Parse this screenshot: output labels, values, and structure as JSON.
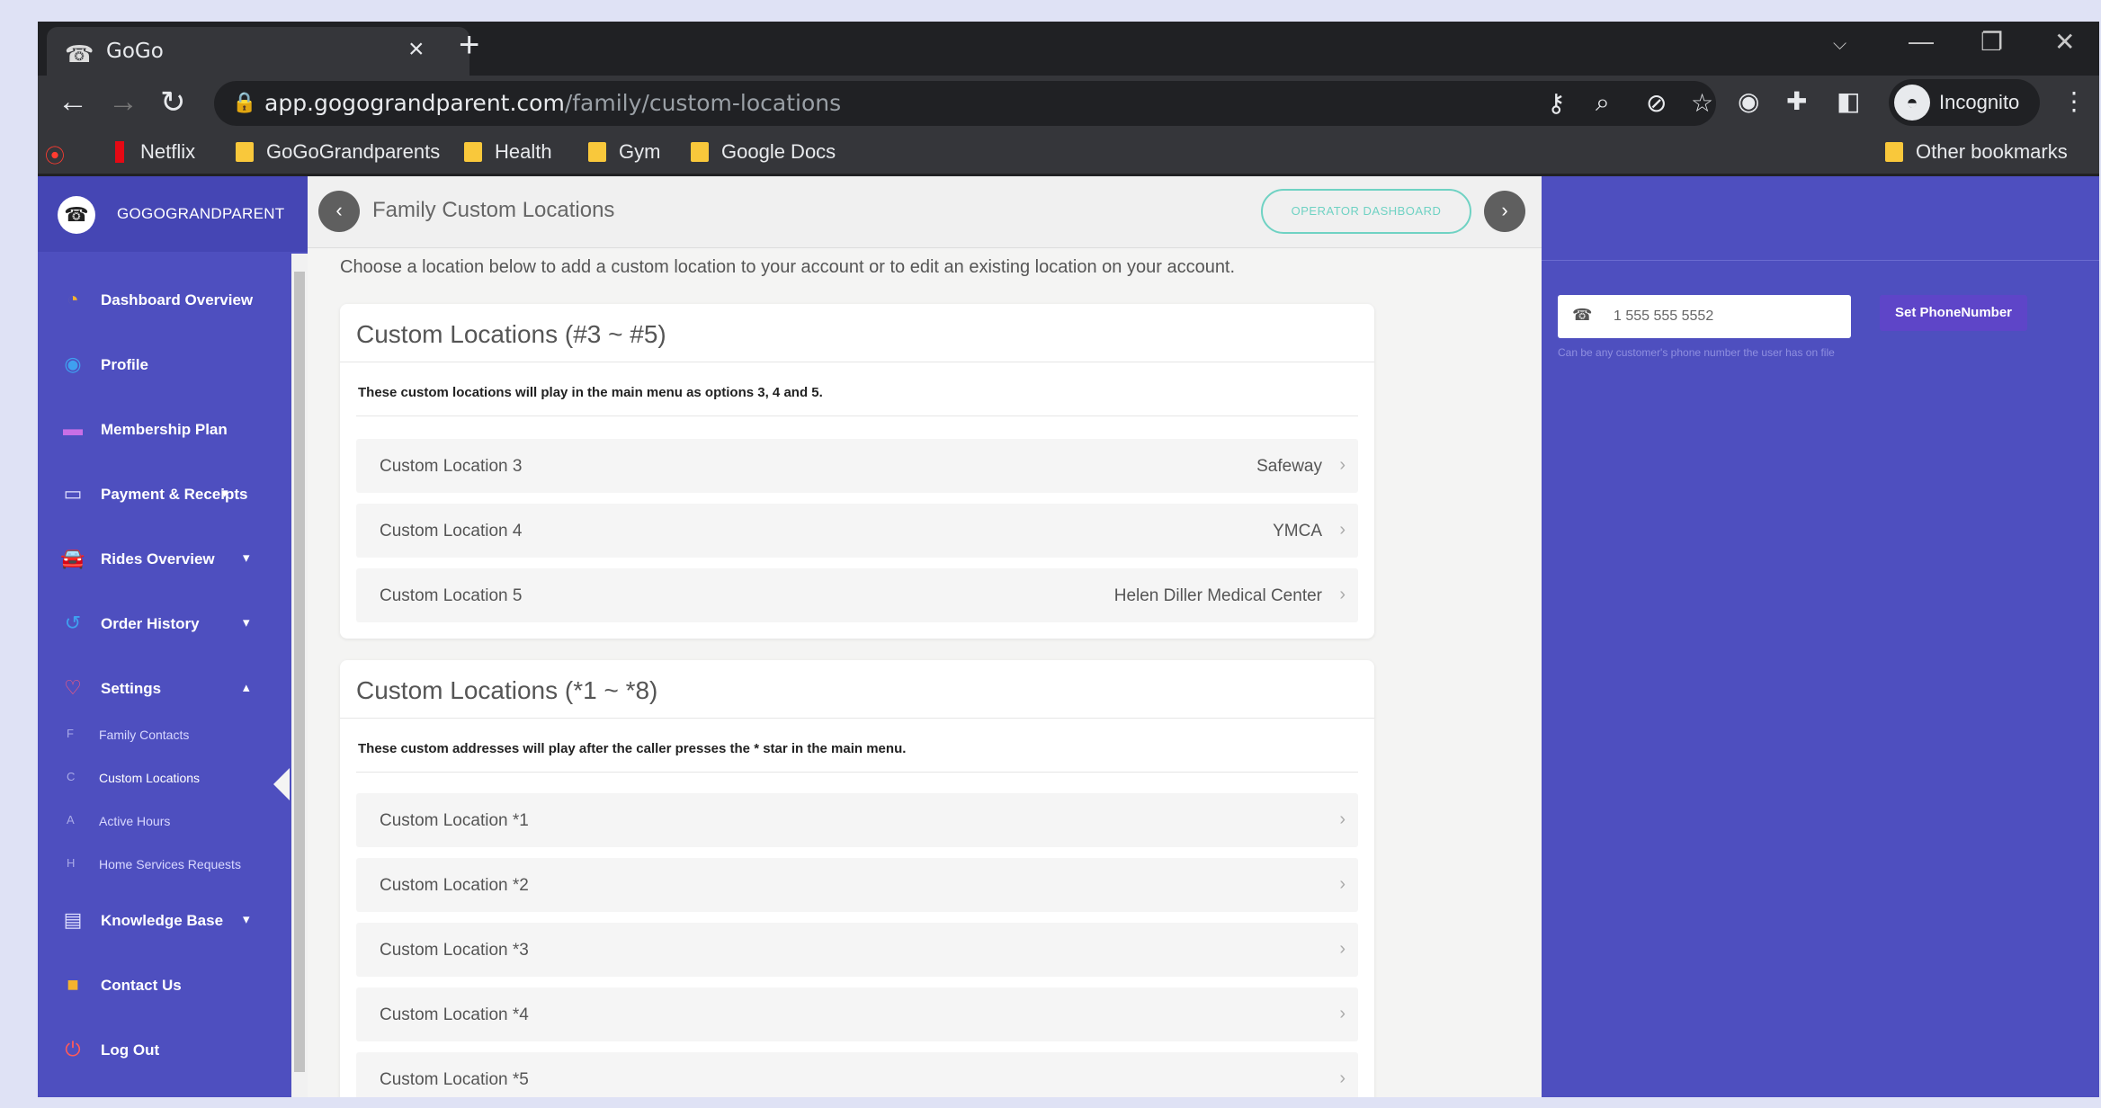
{
  "browser": {
    "tab_title": "GoGo",
    "tab_close": "×",
    "new_tab": "+",
    "url_host": "app.gogograndparent.com",
    "url_path": "/family/custom-locations",
    "incognito_label": "Incognito",
    "bookmarks": [
      "Netflix",
      "GoGoGrandparents",
      "Health",
      "Gym",
      "Google Docs"
    ],
    "other_bookmarks": "Other bookmarks"
  },
  "sidebar": {
    "brand": "GOGOGRANDPARENT",
    "items": [
      {
        "label": "Dashboard Overview",
        "icon": "dashboard-icon",
        "color": "#f5b32e"
      },
      {
        "label": "Profile",
        "icon": "profile-icon",
        "color": "#3fa0f0"
      },
      {
        "label": "Membership Plan",
        "icon": "membership-card-icon",
        "color": "#c86fe6"
      },
      {
        "label": "Payment & Receipts",
        "icon": "payment-icon",
        "caret": "▾",
        "color": "#e0e0ff"
      },
      {
        "label": "Rides Overview",
        "icon": "car-icon",
        "caret": "▾",
        "color": "#f5b32e"
      },
      {
        "label": "Order History",
        "icon": "history-icon",
        "caret": "▾",
        "color": "#3fa0f0"
      },
      {
        "label": "Settings",
        "icon": "heart-icon",
        "caret": "▴",
        "color": "#ff5a7a"
      }
    ],
    "subitems": [
      {
        "label": "Family Contacts",
        "marker": "F"
      },
      {
        "label": "Custom Locations",
        "marker": "C"
      },
      {
        "label": "Active Hours",
        "marker": "A"
      },
      {
        "label": "Home Services Requests",
        "marker": "H"
      }
    ],
    "bottom_items": [
      {
        "label": "Knowledge Base",
        "icon": "book-icon",
        "caret": "▾",
        "color": "#e0e0ff"
      },
      {
        "label": "Contact Us",
        "icon": "contact-icon",
        "color": "#f5b32e"
      },
      {
        "label": "Log Out",
        "icon": "power-icon",
        "color": "#ff5a5a"
      }
    ]
  },
  "main": {
    "title": "Family Custom Locations",
    "operator_button": "OPERATOR DASHBOARD",
    "intro": "Choose a location below to add a custom location to your account or to edit an existing location on your account.",
    "card1": {
      "heading": "Custom Locations (#3 ~ #5)",
      "description": "These custom locations will play in the main menu as options 3, 4 and 5.",
      "rows": [
        {
          "label": "Custom Location 3",
          "value": "Safeway"
        },
        {
          "label": "Custom Location 4",
          "value": "YMCA"
        },
        {
          "label": "Custom Location 5",
          "value": "Helen Diller Medical Center"
        }
      ]
    },
    "card2": {
      "heading": "Custom Locations (*1 ~ *8)",
      "description": "These custom addresses will play after the caller presses the * star in the main menu.",
      "rows": [
        {
          "label": "Custom Location *1",
          "value": ""
        },
        {
          "label": "Custom Location *2",
          "value": ""
        },
        {
          "label": "Custom Location *3",
          "value": ""
        },
        {
          "label": "Custom Location *4",
          "value": ""
        },
        {
          "label": "Custom Location *5",
          "value": ""
        }
      ]
    }
  },
  "right_panel": {
    "phone_value": "1 555 555 5552",
    "set_button": "Set PhoneNumber",
    "hint": "Can be any customer's phone number the user has on file"
  },
  "colors": {
    "sidebar": "#4e4fbf",
    "accent_teal": "#6fd2c3",
    "scroll_button": "#f6c600"
  }
}
